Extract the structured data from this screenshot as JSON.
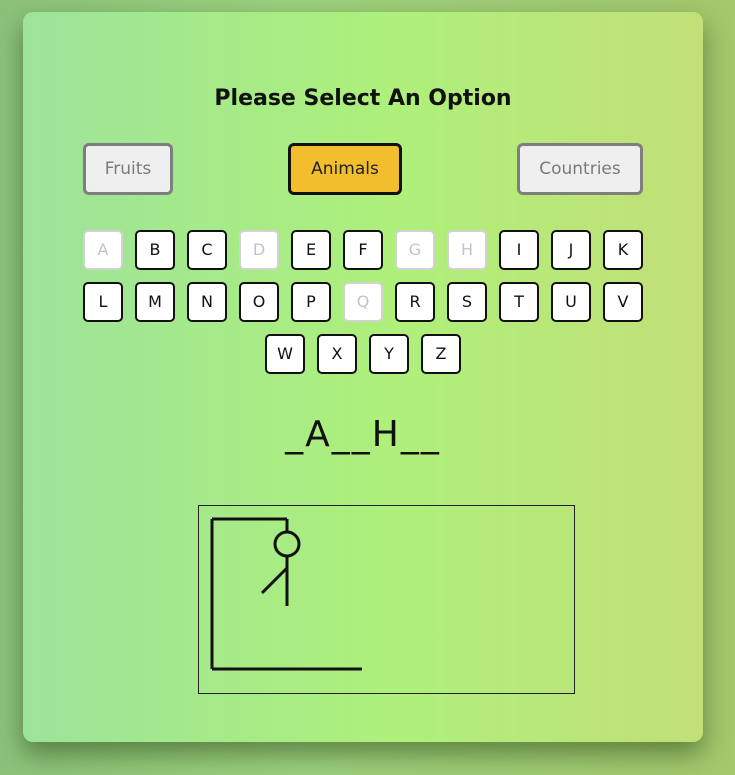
{
  "title": "Please Select An Option",
  "options": [
    {
      "label": "Fruits",
      "active": false
    },
    {
      "label": "Animals",
      "active": true
    },
    {
      "label": "Countries",
      "active": false
    }
  ],
  "letters": [
    {
      "letter": "A",
      "used": true
    },
    {
      "letter": "B",
      "used": false
    },
    {
      "letter": "C",
      "used": false
    },
    {
      "letter": "D",
      "used": true
    },
    {
      "letter": "E",
      "used": false
    },
    {
      "letter": "F",
      "used": false
    },
    {
      "letter": "G",
      "used": true
    },
    {
      "letter": "H",
      "used": true
    },
    {
      "letter": "I",
      "used": false
    },
    {
      "letter": "J",
      "used": false
    },
    {
      "letter": "K",
      "used": false
    },
    {
      "letter": "L",
      "used": false
    },
    {
      "letter": "M",
      "used": false
    },
    {
      "letter": "N",
      "used": false
    },
    {
      "letter": "O",
      "used": false
    },
    {
      "letter": "P",
      "used": false
    },
    {
      "letter": "Q",
      "used": true
    },
    {
      "letter": "R",
      "used": false
    },
    {
      "letter": "S",
      "used": false
    },
    {
      "letter": "T",
      "used": false
    },
    {
      "letter": "U",
      "used": false
    },
    {
      "letter": "V",
      "used": false
    },
    {
      "letter": "W",
      "used": false
    },
    {
      "letter": "X",
      "used": false
    },
    {
      "letter": "Y",
      "used": false
    },
    {
      "letter": "Z",
      "used": false
    }
  ],
  "word_display": "_A__H__",
  "hangman": {
    "parts_drawn": [
      "head",
      "body",
      "left-arm"
    ]
  }
}
